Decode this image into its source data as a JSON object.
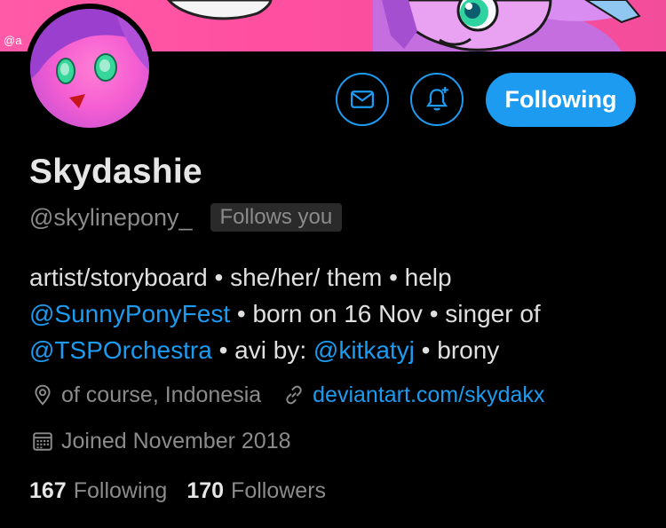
{
  "banner": {
    "watermark": "@a"
  },
  "profile": {
    "display_name": "Skydashie",
    "handle": "@skylinepony_",
    "follows_you": "Follows you",
    "follow_button": "Following"
  },
  "bio": {
    "line1": "artist/storyboard • she/her/ them • help",
    "line2_link": "@SunnyPonyFest",
    "line2_rest": " • born on 16 Nov • singer of",
    "line3_link1": "@TSPOrchestra",
    "line3_mid": " • avi by: ",
    "line3_link2": "@kitkatyj",
    "line3_end": " • brony"
  },
  "meta": {
    "location": "of course, Indonesia",
    "website": "deviantart.com/skydakx",
    "joined": "Joined November 2018"
  },
  "stats": {
    "following_count": "167",
    "following_label": "Following",
    "followers_count": "170",
    "followers_label": "Followers"
  },
  "icons": {
    "message": "envelope-icon",
    "notify": "bell-plus-icon",
    "location": "location-pin-icon",
    "website": "link-icon",
    "joined": "calendar-icon"
  },
  "colors": {
    "accent": "#1d9bf0",
    "banner": "#ff4fa0",
    "background": "#000000",
    "muted_text": "#8b8b8b"
  }
}
